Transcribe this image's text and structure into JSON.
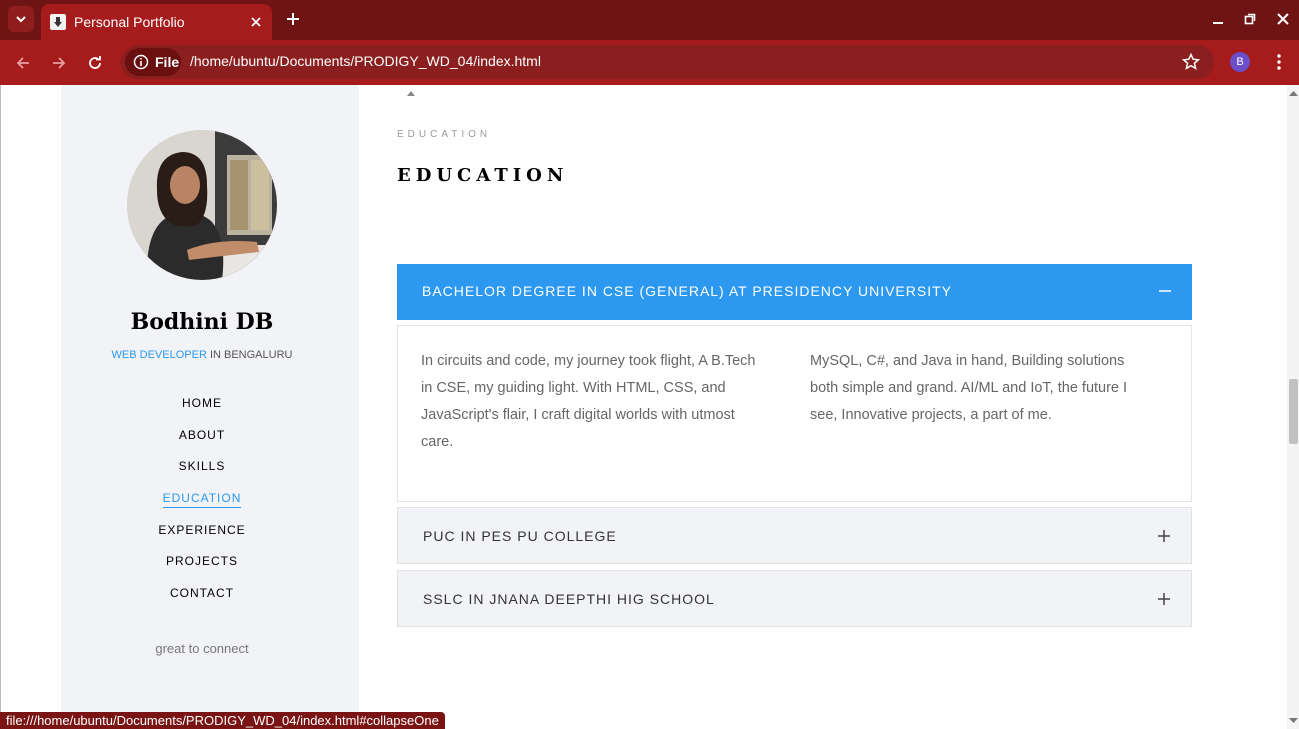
{
  "browser": {
    "tab_title": "Personal Portfolio",
    "url_chip": "File",
    "url": "/home/ubuntu/Documents/PRODIGY_WD_04/index.html",
    "profile_initial": "B",
    "status_url": "file:///home/ubuntu/Documents/PRODIGY_WD_04/index.html#collapseOne",
    "colors": {
      "tabbar": "#6e1414",
      "toolbar": "#a61b1b"
    }
  },
  "sidebar": {
    "name": "Bodhini DB",
    "role_highlight": "WEB DEVELOPER",
    "role_rest": " IN BENGALURU",
    "nav": [
      {
        "label": "HOME",
        "active": false
      },
      {
        "label": "ABOUT",
        "active": false
      },
      {
        "label": "SKILLS",
        "active": false
      },
      {
        "label": "EDUCATION",
        "active": true
      },
      {
        "label": "EXPERIENCE",
        "active": false
      },
      {
        "label": "PROJECTS",
        "active": false
      },
      {
        "label": "CONTACT",
        "active": false
      }
    ],
    "footer": "great to connect"
  },
  "main": {
    "eyebrow": "EDUCATION",
    "title": "EDUCATION",
    "accent_color": "#2c98f0",
    "accordion": [
      {
        "heading": "BACHELOR DEGREE IN CSE (GENERAL) AT PRESIDENCY UNIVERSITY",
        "expanded": true,
        "icon": "minus-icon",
        "col1": "In circuits and code, my journey took flight, A B.Tech in CSE, my guiding light. With HTML, CSS, and JavaScript's flair, I craft digital worlds with utmost care.",
        "col2": "MySQL, C#, and Java in hand, Building solutions both simple and grand. AI/ML and IoT, the future I see, Innovative projects, a part of me."
      },
      {
        "heading": "PUC IN PES PU COLLEGE",
        "expanded": false,
        "icon": "plus-icon"
      },
      {
        "heading": "SSLC IN JNANA DEEPTHI HIG SCHOOL",
        "expanded": false,
        "icon": "plus-icon"
      }
    ]
  }
}
